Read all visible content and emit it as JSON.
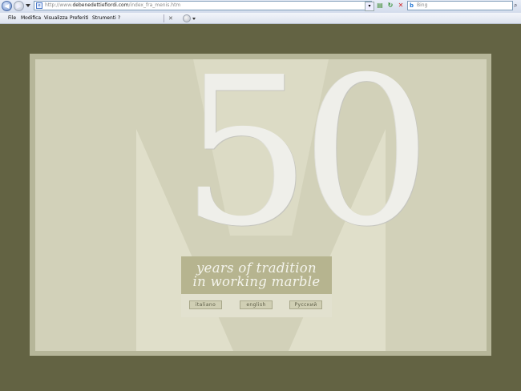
{
  "browser": {
    "address": {
      "prefix": "http://www.",
      "domain": "debenedettiefiordi.com",
      "path": "/index_fra_menis.htm"
    },
    "search": {
      "placeholder": "Bing"
    },
    "menu": [
      "File",
      "Modifica",
      "Visualizza",
      "Preferiti",
      "Strumenti",
      "?"
    ]
  },
  "page": {
    "big_number": "50",
    "slogan_line1": "years of tradition",
    "slogan_line2": "in working marble",
    "languages": [
      "italiano",
      "english",
      "Русский"
    ]
  },
  "colors": {
    "background": "#636343",
    "frame": "#b6b699",
    "panel": "#d2d1b9",
    "m_shape": "#e0dfca",
    "slogan_band": "#b6b48f"
  }
}
